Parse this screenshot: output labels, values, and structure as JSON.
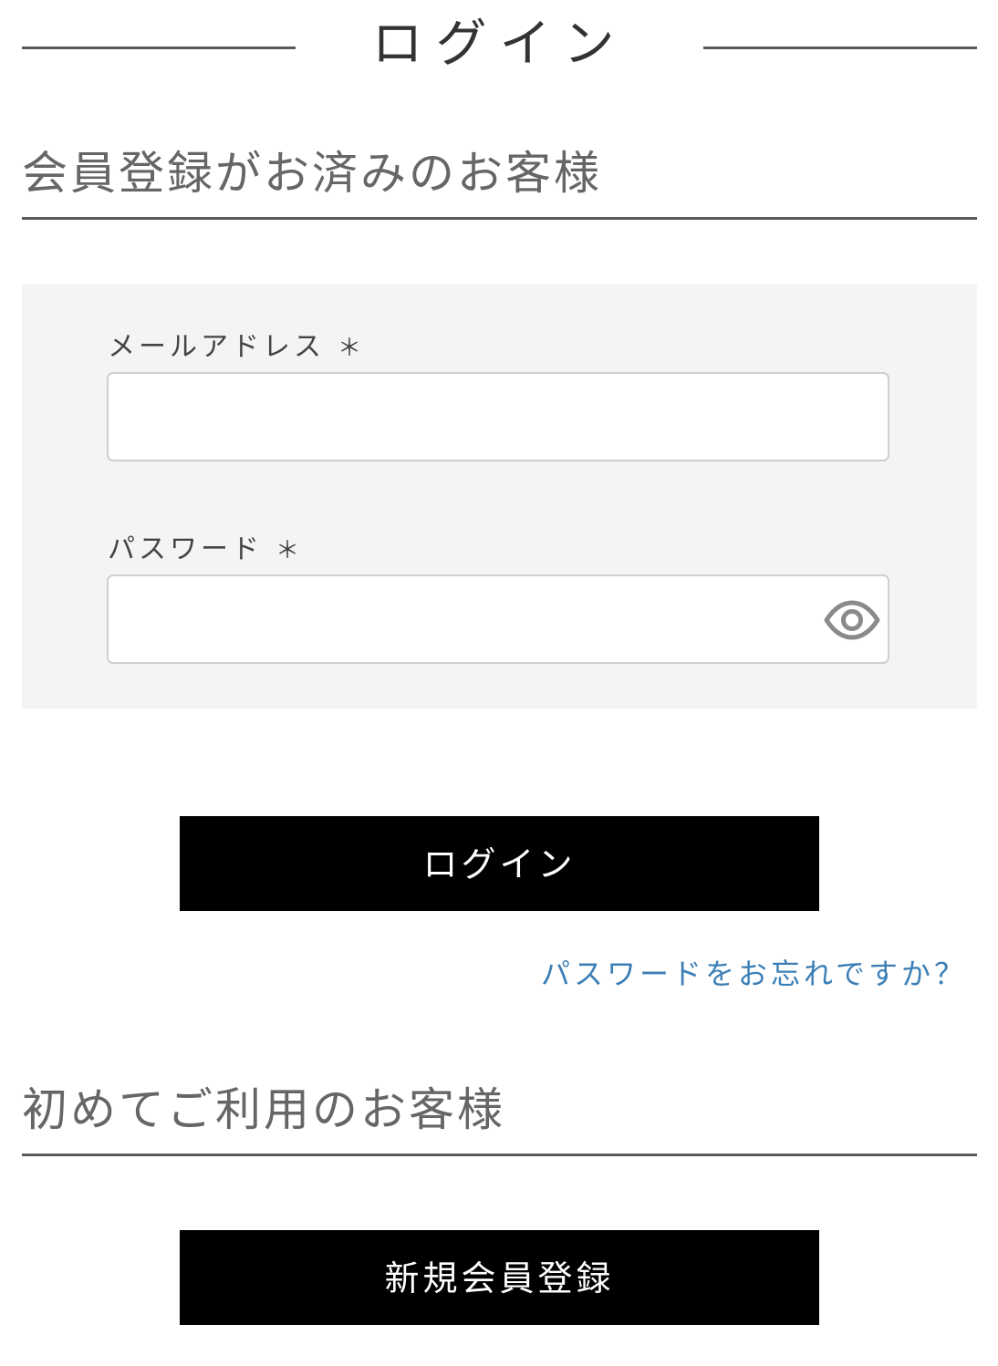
{
  "header": {
    "title": "ログイン"
  },
  "member_section": {
    "heading": "会員登録がお済みのお客様",
    "email": {
      "label": "メールアドレス",
      "required_mark": "＊",
      "value": "",
      "placeholder": ""
    },
    "password": {
      "label": "パスワード",
      "required_mark": "＊",
      "value": "",
      "placeholder": "",
      "toggle_icon": "eye-icon"
    },
    "login_button": "ログイン",
    "forgot_password_link": "パスワードをお忘れですか？"
  },
  "new_section": {
    "heading": "初めてご利用のお客様",
    "register_button": "新規会員登録"
  },
  "colors": {
    "button_bg": "#000000",
    "button_text": "#ffffff",
    "link": "#3c7fb6",
    "panel_bg": "#f4f4f4",
    "rule": "#5a5a5a"
  }
}
